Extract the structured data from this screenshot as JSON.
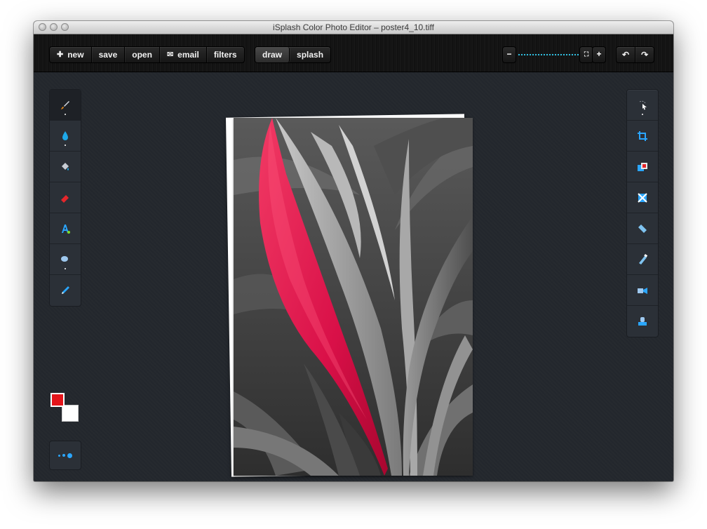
{
  "window": {
    "title": "iSplash Color Photo Editor – poster4_10.tiff"
  },
  "toolbar": {
    "new_label": "new",
    "save_label": "save",
    "open_label": "open",
    "email_label": "email",
    "filters_label": "filters",
    "draw_label": "draw",
    "splash_label": "splash",
    "zoom_out_label": "−",
    "zoom_in_label": "+",
    "fit_label": "⛶",
    "undo_label": "↶",
    "redo_label": "↷",
    "active_mode": "draw",
    "zoom_level": 0.95
  },
  "left_tools": [
    {
      "name": "brush-icon",
      "active": true
    },
    {
      "name": "drop-icon",
      "active": false
    },
    {
      "name": "paint-bucket-icon",
      "active": false
    },
    {
      "name": "eraser-icon",
      "active": false
    },
    {
      "name": "text-icon",
      "active": false
    },
    {
      "name": "smudge-icon",
      "active": false
    },
    {
      "name": "pen-icon",
      "active": false
    }
  ],
  "right_tools": [
    {
      "name": "select-icon"
    },
    {
      "name": "crop-icon"
    },
    {
      "name": "layers-icon"
    },
    {
      "name": "transform-icon"
    },
    {
      "name": "ruler-icon"
    },
    {
      "name": "pencil-icon"
    },
    {
      "name": "video-icon"
    },
    {
      "name": "stamp-icon"
    }
  ],
  "colors": {
    "foreground": "#e4151b",
    "background": "#ffffff",
    "accent": "#32c7ea"
  }
}
